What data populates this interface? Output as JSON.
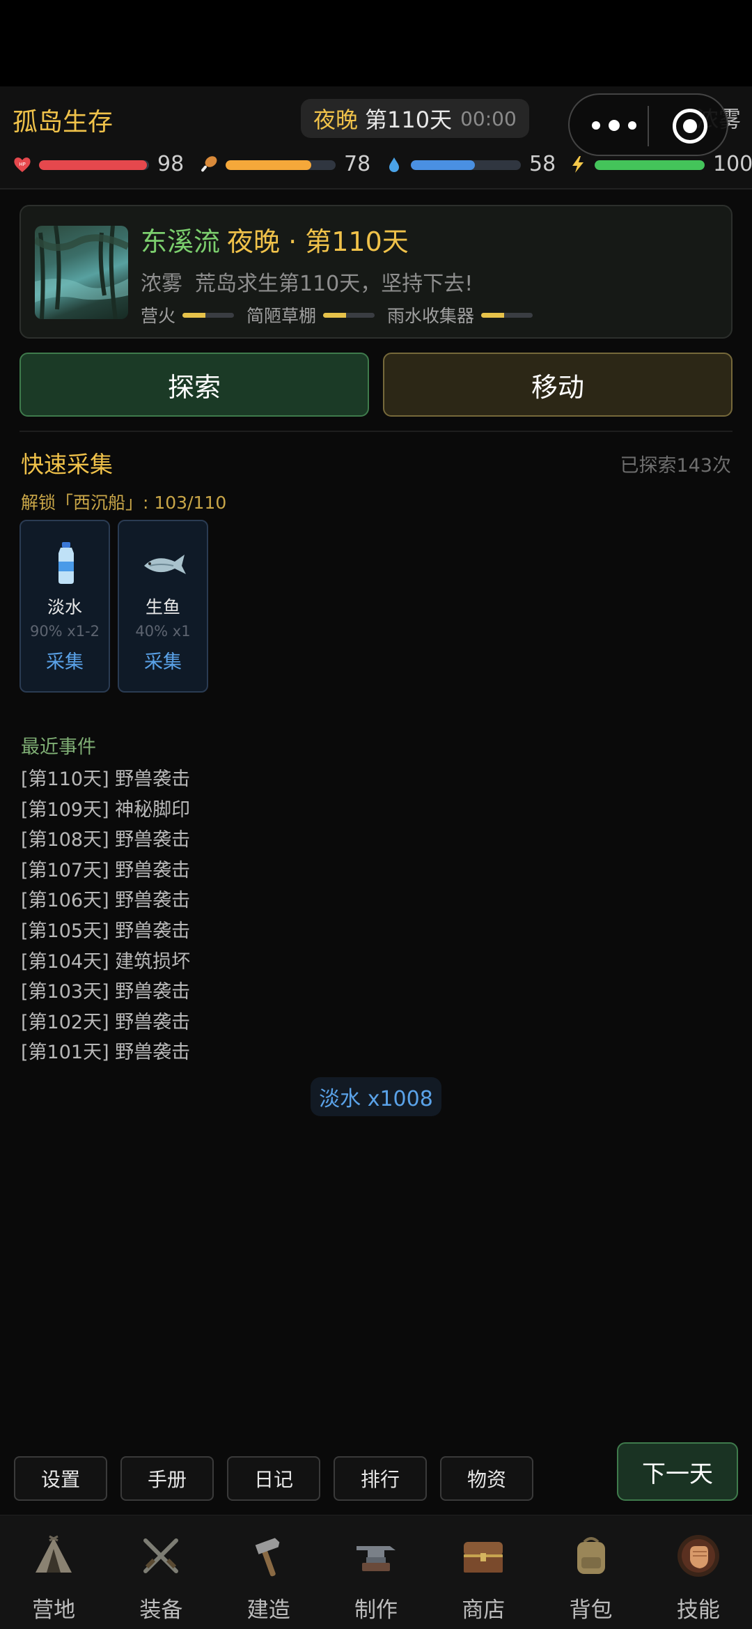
{
  "header": {
    "title": "孤岛生存",
    "period": "夜晚",
    "day": "第110天",
    "time": "00:00",
    "weather": "浓雾",
    "stats": [
      {
        "icon": "hp-heart-icon",
        "value": "98",
        "fraction": 0.98,
        "color": "#e5484d"
      },
      {
        "icon": "food-drumstick-icon",
        "value": "78",
        "fraction": 0.78,
        "color": "#f5a83a"
      },
      {
        "icon": "water-drop-icon",
        "value": "58",
        "fraction": 0.58,
        "color": "#4a90e2"
      },
      {
        "icon": "energy-bolt-icon",
        "value": "100",
        "fraction": 1.0,
        "color": "#44c45a"
      }
    ]
  },
  "location": {
    "name": "东溪流",
    "time_label": "夜晚 · 第110天",
    "weather": "浓雾",
    "message": "荒岛求生第110天，坚持下去!",
    "buildings": [
      {
        "name": "营火",
        "level": 0.45
      },
      {
        "name": "简陋草棚",
        "level": 0.45
      },
      {
        "name": "雨水收集器",
        "level": 0.45
      }
    ]
  },
  "actions": {
    "explore": "探索",
    "move": "移动"
  },
  "quick_collect": {
    "title": "快速采集",
    "explored": "已探索143次",
    "unlock": "解锁「西沉船」: 103/110",
    "items": [
      {
        "icon": "water-bottle-icon",
        "name": "淡水",
        "rate": "90% x1-2",
        "action": "采集"
      },
      {
        "icon": "fish-icon",
        "name": "生鱼",
        "rate": "40% x1",
        "action": "采集"
      }
    ]
  },
  "events": {
    "title": "最近事件",
    "items": [
      "[第110天] 野兽袭击",
      "[第109天] 神秘脚印",
      "[第108天] 野兽袭击",
      "[第107天] 野兽袭击",
      "[第106天] 野兽袭击",
      "[第105天] 野兽袭击",
      "[第104天] 建筑损坏",
      "[第103天] 野兽袭击",
      "[第102天] 野兽袭击",
      "[第101天] 野兽袭击"
    ]
  },
  "toast": "淡水 x1008",
  "toolbar": {
    "buttons": [
      "设置",
      "手册",
      "日记",
      "排行",
      "物资"
    ],
    "next_day": "下一天"
  },
  "nav": [
    {
      "icon": "camp-tent-icon",
      "label": "营地"
    },
    {
      "icon": "crossed-swords-icon",
      "label": "装备"
    },
    {
      "icon": "hammer-icon",
      "label": "建造"
    },
    {
      "icon": "anvil-icon",
      "label": "制作"
    },
    {
      "icon": "treasure-chest-icon",
      "label": "商店"
    },
    {
      "icon": "backpack-icon",
      "label": "背包"
    },
    {
      "icon": "fist-icon",
      "label": "技能"
    }
  ]
}
